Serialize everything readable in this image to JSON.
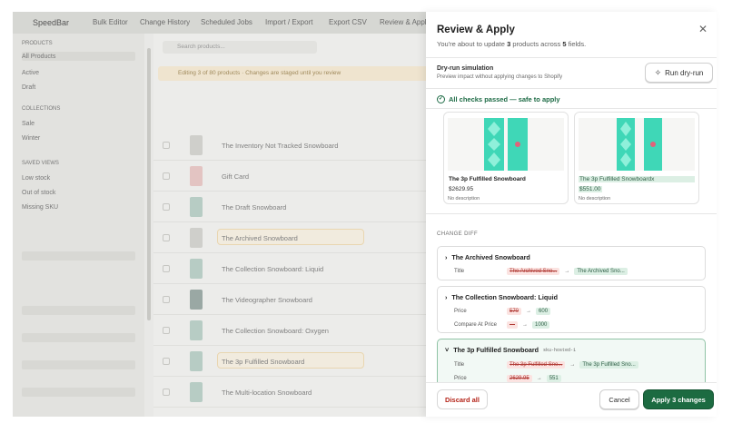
{
  "background_app": {
    "brand": "SpeedBar",
    "tabs": [
      "Bulk Editor",
      "Change History",
      "Scheduled Jobs",
      "Import / Export",
      "Export CSV",
      "Review & Apply"
    ],
    "search_placeholder": "Search products...",
    "banner_text": "Editing 3 of 80 products · Changes are staged until you review",
    "sidebar_items": [
      "PRODUCTS",
      "All Products",
      "Active",
      "Draft",
      "COLLECTIONS",
      "Sale",
      "Winter",
      "SAVED VIEWS",
      "Low stock",
      "Out of stock",
      "Missing SKU"
    ],
    "product_rows": [
      "The Inventory Not Tracked Snowboard",
      "Gift Card",
      "The Draft Snowboard",
      "The Archived Snowboard",
      "The Collection Snowboard: Liquid",
      "The Videographer Snowboard",
      "The Collection Snowboard: Oxygen",
      "The 3p Fulfilled Snowboard",
      "The Multi-location Snowboard"
    ]
  },
  "panel": {
    "title": "Review & Apply",
    "subtitle_prefix": "You're about to update ",
    "product_count": "3",
    "subtitle_mid": " products across ",
    "field_count": "5",
    "subtitle_suffix": " fields.",
    "dry_run": {
      "title": "Dry-run simulation",
      "description": "Preview impact without applying changes to Shopify",
      "button_label": "Run dry-run"
    },
    "checks_status": "All checks passed — safe to apply",
    "preview_cards": [
      {
        "name": "The 3p Fulfilled Snowboard",
        "price": "$2629.95",
        "description": "No description",
        "changed": false
      },
      {
        "name": "The 3p Fulfilled Snowboardx",
        "price": "$551.00",
        "description": "No description",
        "changed": true
      }
    ],
    "change_diff_label": "CHANGE DIFF",
    "diffs": [
      {
        "product": "The Archived Snowboard",
        "sku": "",
        "expanded": false,
        "fields": [
          {
            "label": "Title",
            "old": "The Archived Sno...",
            "new": "The Archived Sno..."
          }
        ]
      },
      {
        "product": "The Collection Snowboard: Liquid",
        "sku": "",
        "expanded": false,
        "fields": [
          {
            "label": "Price",
            "old": "570",
            "new": "600"
          },
          {
            "label": "Compare At Price",
            "old": "—",
            "new": "1000"
          }
        ]
      },
      {
        "product": "The 3p Fulfilled Snowboard",
        "sku": "sku-hosted-1",
        "expanded": true,
        "fields": [
          {
            "label": "Title",
            "old": "The 3p Fulfilled Sno...",
            "new": "The 3p Fulfilled Sno..."
          },
          {
            "label": "Price",
            "old": "2629.95",
            "new": "551"
          }
        ]
      }
    ],
    "buttons": {
      "discard": "Discard all",
      "cancel": "Cancel",
      "apply": "Apply 3 changes"
    }
  },
  "colors": {
    "accent": "#1c6b41",
    "danger": "#b42318",
    "success": "#1d6b45",
    "board_teal": "#3fd7b7"
  }
}
